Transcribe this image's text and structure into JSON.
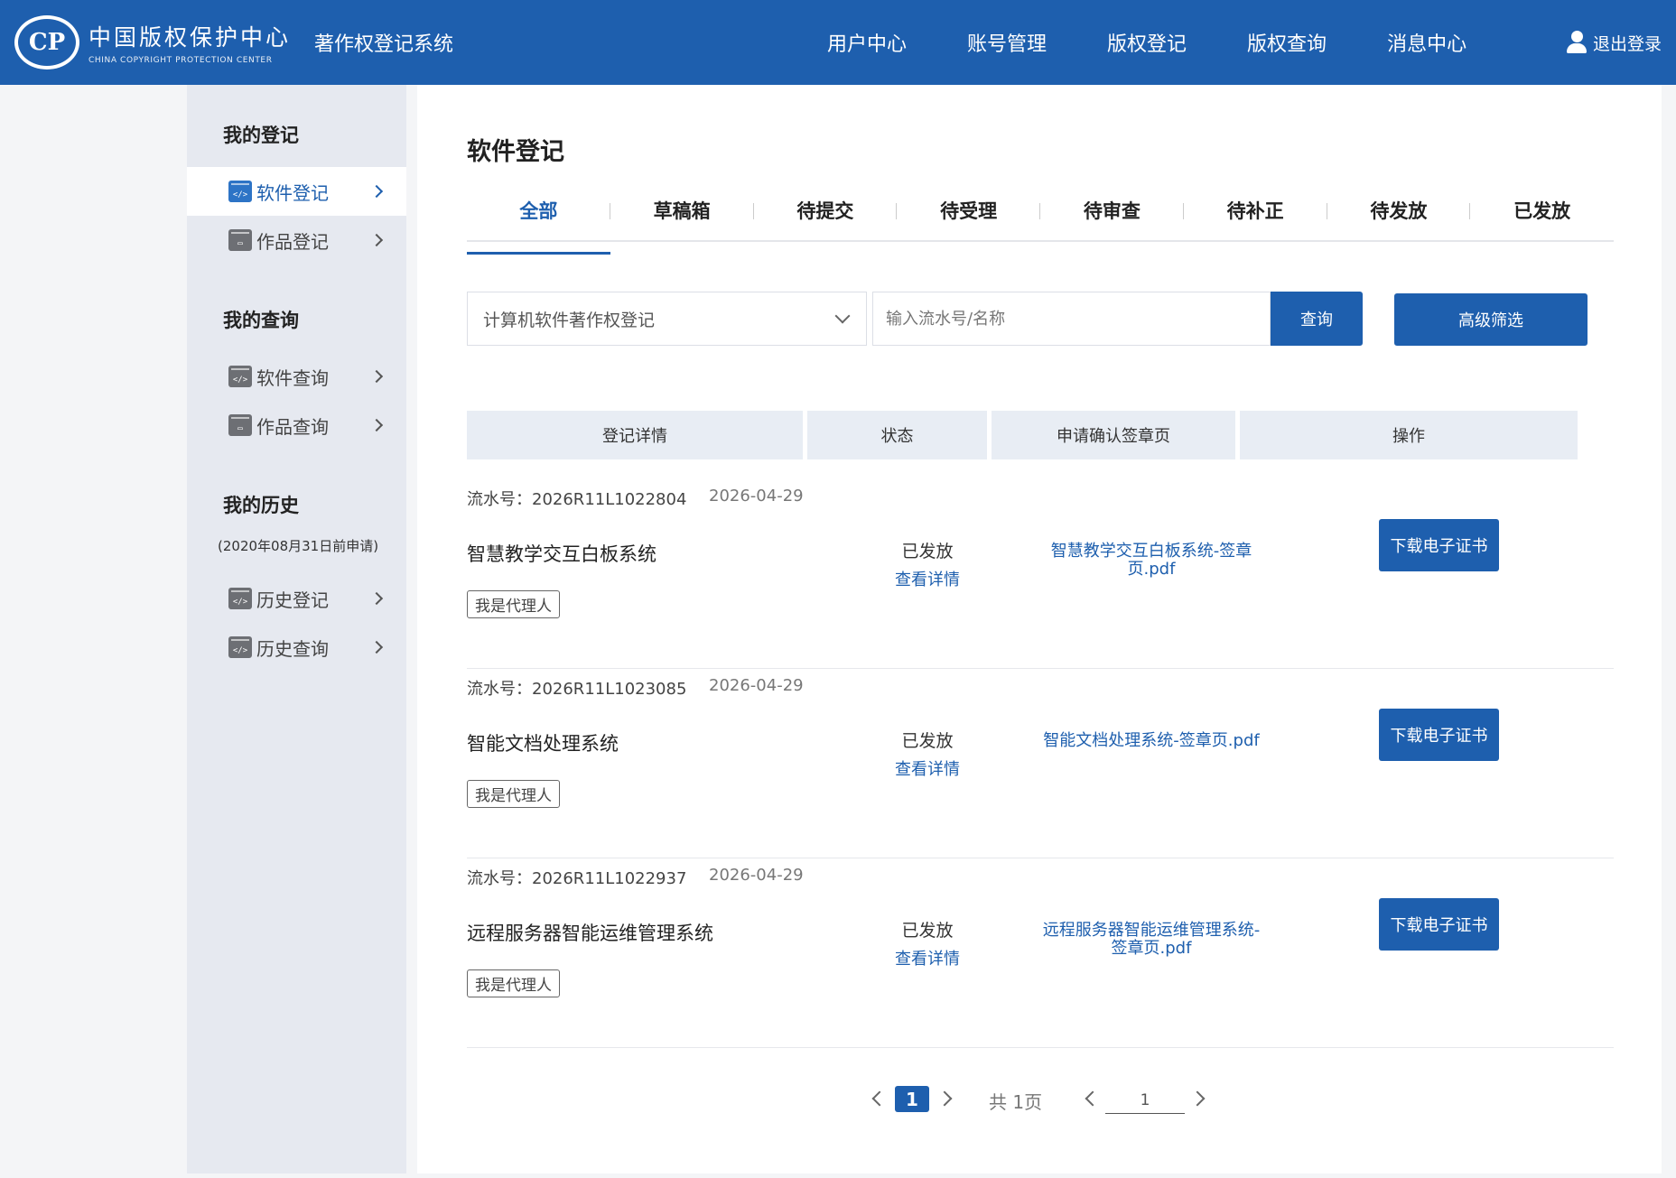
{
  "header": {
    "logo_glyph": "CP",
    "logo_cn": "中国版权保护中心",
    "logo_en": "CHINA COPYRIGHT PROTECTION CENTER",
    "system_name": "著作权登记系统",
    "nav": [
      "用户中心",
      "账号管理",
      "版权登记",
      "版权查询",
      "消息中心"
    ],
    "logout": "退出登录",
    "bg_color": "#1e5fae"
  },
  "sidebar": {
    "section_register": "我的登记",
    "items_register": [
      {
        "label": "软件登记",
        "icon": "software-icon",
        "active": true
      },
      {
        "label": "作品登记",
        "icon": "work-icon",
        "active": false
      }
    ],
    "section_query": "我的查询",
    "items_query": [
      {
        "label": "软件查询",
        "icon": "software-icon"
      },
      {
        "label": "作品查询",
        "icon": "work-icon"
      }
    ],
    "section_history": "我的历史",
    "history_note": "(2020年08月31日前申请)",
    "items_history": [
      {
        "label": "历史登记",
        "icon": "software-icon"
      },
      {
        "label": "历史查询",
        "icon": "software-icon"
      }
    ]
  },
  "main": {
    "title": "软件登记",
    "tabs": [
      "全部",
      "草稿箱",
      "待提交",
      "待受理",
      "待审查",
      "待补正",
      "待发放",
      "已发放"
    ],
    "active_tab": "全部",
    "filter": {
      "type_value": "计算机软件著作权登记",
      "search_placeholder": "输入流水号/名称",
      "search_button": "查询",
      "advanced_button": "高级筛选"
    },
    "table_headers": [
      "登记详情",
      "状态",
      "申请确认签章页",
      "操作"
    ],
    "rows": [
      {
        "serial": "流水号：2026R11L1022804",
        "date": "2026-04-29",
        "name": "智慧教学交互白板系统",
        "tag": "我是代理人",
        "status": "已发放",
        "detail_link": "查看详情",
        "pdf_line1": "智慧教学交互白板系统-签章",
        "pdf_line2": "页.pdf",
        "action": "下载电子证书"
      },
      {
        "serial": "流水号：2026R11L1023085",
        "date": "2026-04-29",
        "name": "智能文档处理系统",
        "tag": "我是代理人",
        "status": "已发放",
        "detail_link": "查看详情",
        "pdf_line1": "智能文档处理系统-签章页.pdf",
        "pdf_line2": "",
        "action": "下载电子证书"
      },
      {
        "serial": "流水号：2026R11L1022937",
        "date": "2026-04-29",
        "name": "远程服务器智能运维管理系统",
        "tag": "我是代理人",
        "status": "已发放",
        "detail_link": "查看详情",
        "pdf_line1": "远程服务器智能运维管理系统-",
        "pdf_line2": "签章页.pdf",
        "action": "下载电子证书"
      }
    ],
    "pagination": {
      "current_page": "1",
      "total": "共 1页",
      "jump_value": "1"
    }
  }
}
